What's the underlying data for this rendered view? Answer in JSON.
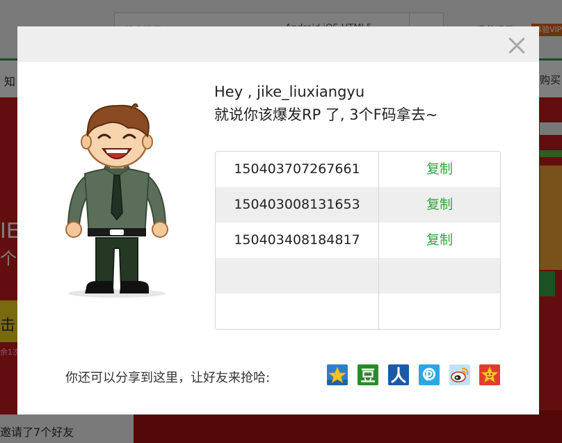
{
  "background": {
    "search_placeholder": "搜索课程",
    "search_tags": "Android  iOS  HTML5",
    "nav_right": "我的课程 |",
    "vip_badge": "体验VIP",
    "nav_left": "知",
    "nav_buy": "购买",
    "invite_text": "邀请了7个好友",
    "big_letters": "IE",
    "big_letters2": "个",
    "yellow_text": "击",
    "small_text": "余1次"
  },
  "modal": {
    "greeting_line1": "Hey , jike_liuxiangyu",
    "greeting_line2": "就说你该爆发RP 了, 3个F码拿去~",
    "codes": [
      {
        "code": "150403707267661",
        "action": "复制"
      },
      {
        "code": "150403008131653",
        "action": "复制"
      },
      {
        "code": "150403408184817",
        "action": "复制"
      },
      {
        "code": "",
        "action": ""
      },
      {
        "code": "",
        "action": ""
      }
    ],
    "share_prompt": "你还可以分享到这里，让好友来抢哈:",
    "share_icons": [
      "qzone-icon",
      "douban-icon",
      "renren-icon",
      "kaixin-icon",
      "weibo-icon",
      "pengyou-icon"
    ]
  },
  "colors": {
    "accent_green": "#33a33f",
    "header_gray": "#eeeeee",
    "background_red": "#c61d1d"
  }
}
